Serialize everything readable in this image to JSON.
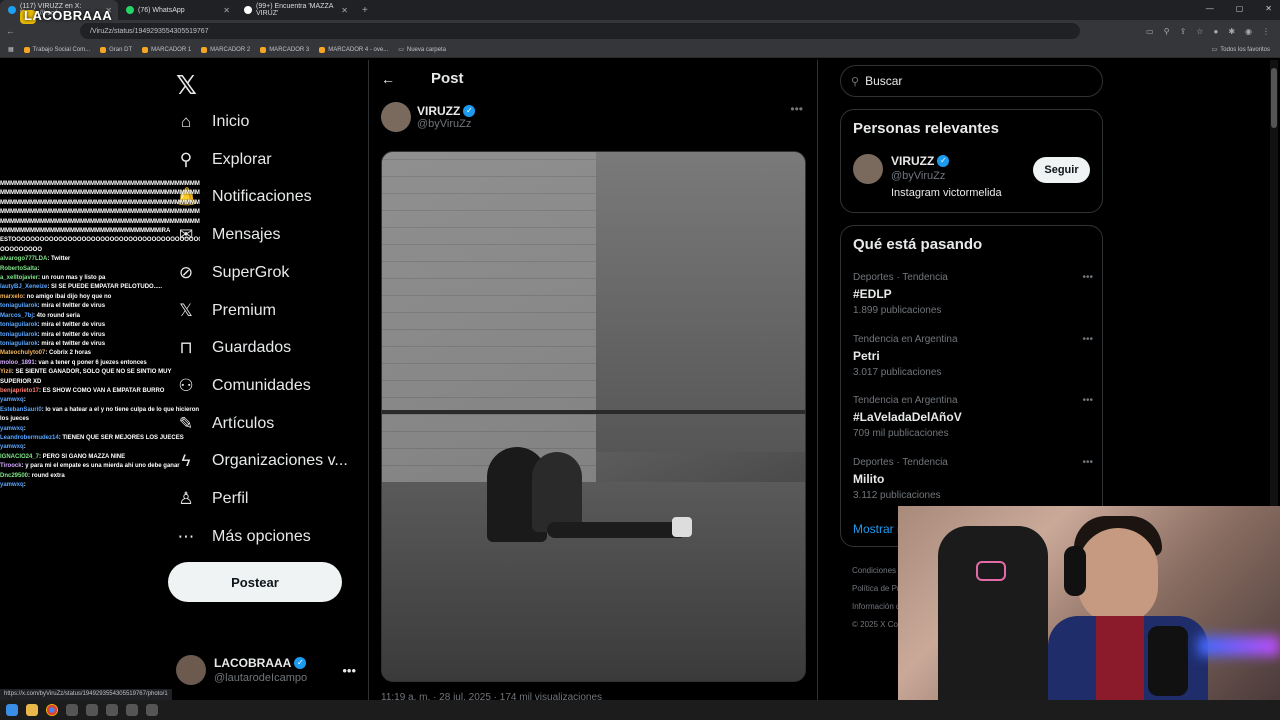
{
  "browser": {
    "tabs": [
      {
        "label": "(117) VIRUZZ en X: \"https://t.co/",
        "icon": "x-favicon",
        "active": true
      },
      {
        "label": "(76) WhatsApp",
        "icon": "whatsapp-favicon",
        "active": false
      },
      {
        "label": "(99+) Encuentra 'MAZZA VIRUZ'",
        "icon": "tiktok-favicon",
        "active": false
      }
    ],
    "url": "/ViruZz/status/1949293554305519767",
    "bookmarks": [
      "Trabajo Social Com...",
      "Gran DT",
      "MARCADOR 1",
      "MARCADOR 2",
      "MARCADOR 3",
      "MARCADOR 4 - ove...",
      "Nueva carpeta"
    ],
    "bookmarks_right": "Todos los favoritos",
    "status_url": "https://x.com/byViruZz/status/1949293554305519767/photo/1"
  },
  "overlay": {
    "stream_name": "LACOBRAAA",
    "chat": [
      {
        "user": "",
        "text": "MMMMMMMMMMMMMMMMMMMMMMMMMMMMMMMMMMMMMMMM",
        "color": "",
        "wrap": false
      },
      {
        "user": "",
        "text": "MMMMMMMMMMMMMMMMMMMMMMMMMMMMMMMMMMMMMMMM",
        "color": "",
        "wrap": false
      },
      {
        "user": "",
        "text": "MMMMMMMMMMMMMMMMMMMMMMMMMMMMMMMMMMMMMMMM",
        "color": "",
        "wrap": false
      },
      {
        "user": "",
        "text": "MMMMMMMMMMMMMMMMMMMMMMMMMMMMMMMMMMMMMMMM",
        "color": "",
        "wrap": false
      },
      {
        "user": "",
        "text": "MMMMMMMMMMMMMMMMMMMMMMMMMMMMMMMMMMMMMMMM",
        "color": "",
        "wrap": false
      },
      {
        "user": "",
        "text": "MMMMMMMMMMMMMMMMMMMMMMMMMMMMMMMMIRA",
        "color": "",
        "wrap": false
      },
      {
        "user": "",
        "text": "ESTOOOOOOOOOOOOOOOOOOOOOOOOOOOOOOOOOOOOOOOOOOOOOOOO",
        "color": "",
        "wrap": false
      },
      {
        "user": "",
        "text": "OOOOOOOOO",
        "color": "",
        "wrap": false
      },
      {
        "user": "alvarogo777LDA",
        "text": ": Twitter",
        "color": "g"
      },
      {
        "user": "RobertoSalta",
        "text": ":",
        "color": "g"
      },
      {
        "user": "a_xelltojavier",
        "text": ": un roun mas y listo pa",
        "color": "g"
      },
      {
        "user": "lautyBJ_Xeneize",
        "text": ": SI SE PUEDE EMPATAR PELOTUDO.....",
        "color": "b"
      },
      {
        "user": "marxelo",
        "text": ": no amigo ibai dijo hoy que no",
        "color": "o"
      },
      {
        "user": "toniaguilarok",
        "text": ": mira el twitter de virus",
        "color": "b"
      },
      {
        "user": "Marcos_7bj",
        "text": ": 4to round seria",
        "color": "b"
      },
      {
        "user": "toniaguilarok",
        "text": ": mira el twitter de virus",
        "color": "b"
      },
      {
        "user": "toniaguilarok",
        "text": ": mira el twitter de virus",
        "color": "b"
      },
      {
        "user": "toniaguilarok",
        "text": ": mira el twitter de virus",
        "color": "b"
      },
      {
        "user": "Mateochulyto07",
        "text": ": Cobrix 2 horas",
        "color": "o"
      },
      {
        "user": "moloo_1891",
        "text": ": van a tener q poner 6 juezes entonces",
        "color": "p"
      },
      {
        "user": "Yizil",
        "text": ": SE SIENTE GANADOR, SOLO QUE NO SE SINTIÓ MUY SUPERIOR XD",
        "color": "o",
        "wrap": true
      },
      {
        "user": "benjaprieto17",
        "text": ": ES SHOW COMO VAN A EMPATAR BURRO",
        "color": "r"
      },
      {
        "user": "yamwxq",
        "text": ":",
        "color": "b"
      },
      {
        "user": "EstebanSauri0",
        "text": ": lo van a hatear a el y no tiene culpa de lo que hicieron los jueces",
        "color": "b",
        "wrap": true
      },
      {
        "user": "yamwxq",
        "text": ":",
        "color": "b"
      },
      {
        "user": "Leandrobermudez14",
        "text": ": TIENEN QUE SER MEJORES LOS JUECES",
        "color": "b"
      },
      {
        "user": "yamwxq",
        "text": ":",
        "color": "b"
      },
      {
        "user": "IGNACIO24_7",
        "text": ": PERO SI GANO MAZZA NINE",
        "color": "g"
      },
      {
        "user": "Tiroock",
        "text": ": y para mi el empate es una mierda ahi uno debe ganar",
        "color": "p"
      },
      {
        "user": "Dnc29500",
        "text": ": round extra",
        "color": "g"
      },
      {
        "user": "yamwxq",
        "text": ":",
        "color": "b"
      }
    ]
  },
  "leftnav": {
    "items": [
      {
        "label": "Inicio",
        "icon": "home-icon",
        "glyph": "⌂"
      },
      {
        "label": "Explorar",
        "icon": "search-icon",
        "glyph": "⚲"
      },
      {
        "label": "Notificaciones",
        "icon": "bell-icon",
        "glyph": "🔔"
      },
      {
        "label": "Mensajes",
        "icon": "mail-icon",
        "glyph": "✉"
      },
      {
        "label": "SuperGrok",
        "icon": "grok-icon",
        "glyph": "⊘"
      },
      {
        "label": "Premium",
        "icon": "x-premium-icon",
        "glyph": "𝕏"
      },
      {
        "label": "Guardados",
        "icon": "bookmark-icon",
        "glyph": "⊓"
      },
      {
        "label": "Comunidades",
        "icon": "communities-icon",
        "glyph": "⚇"
      },
      {
        "label": "Artículos",
        "icon": "articles-icon",
        "glyph": "✎"
      },
      {
        "label": "Organizaciones v...",
        "icon": "lightning-icon",
        "glyph": "ϟ"
      },
      {
        "label": "Perfil",
        "icon": "profile-icon",
        "glyph": "♙"
      },
      {
        "label": "Más opciones",
        "icon": "more-options-icon",
        "glyph": "⋯"
      }
    ],
    "post_button": "Postear",
    "account": {
      "name": "LACOBRAAA",
      "handle": "@lautarodeIcampo"
    }
  },
  "post": {
    "header_title": "Post",
    "author": {
      "name": "VIRUZZ",
      "handle": "@byViruZz"
    },
    "timestamp": "11:19 a. m. · 28 jul. 2025 · 174 mil visualizaciones"
  },
  "search": {
    "placeholder": "Buscar"
  },
  "relevant": {
    "title": "Personas relevantes",
    "person": {
      "name": "VIRUZZ",
      "handle": "@byViruZz",
      "bio": "Instagram victormelida"
    },
    "follow_label": "Seguir"
  },
  "trends": {
    "title": "Qué está pasando",
    "items": [
      {
        "meta": "Deportes · Tendencia",
        "name": "#EDLP",
        "count": "1.899 publicaciones"
      },
      {
        "meta": "Tendencia en Argentina",
        "name": "Petri",
        "count": "3.017 publicaciones"
      },
      {
        "meta": "Tendencia en Argentina",
        "name": "#LaVeladaDelAñoV",
        "count": "709 mil publicaciones"
      },
      {
        "meta": "Deportes · Tendencia",
        "name": "Milito",
        "count": "3.112 publicaciones"
      }
    ],
    "show_more": "Mostrar más"
  },
  "footer": [
    "Condiciones de Servicio",
    "Política de Privacidad",
    "Información de anuncios",
    "© 2025 X Corp."
  ],
  "colors": {
    "accent": "#1d9bf0",
    "background": "#000000",
    "border": "#2f3336",
    "muted": "#71767b"
  }
}
